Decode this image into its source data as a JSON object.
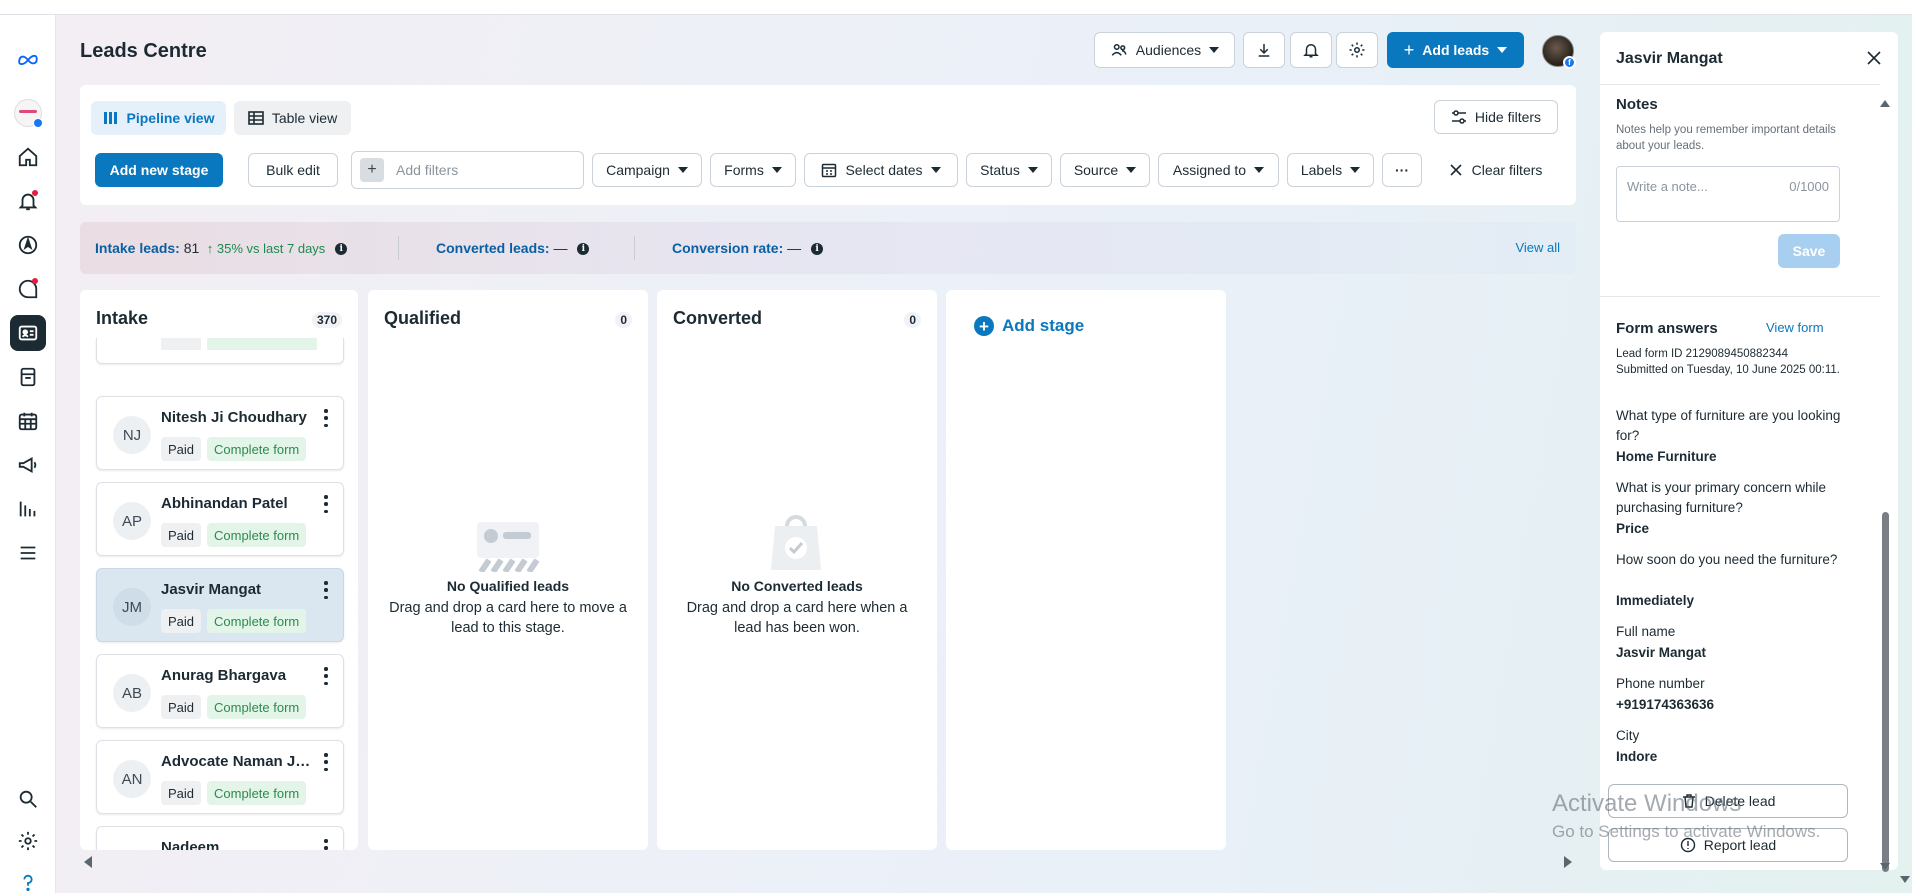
{
  "page": {
    "title": "Leads Centre"
  },
  "header": {
    "audiences_label": "Audiences",
    "add_leads_label": "Add leads"
  },
  "toolbar": {
    "pipeline_view": "Pipeline view",
    "table_view": "Table view",
    "hide_filters": "Hide filters",
    "add_new_stage": "Add new stage",
    "bulk_edit": "Bulk edit",
    "add_filters_placeholder": "Add filters",
    "filters": [
      "Campaign",
      "Forms",
      "Select dates",
      "Status",
      "Source",
      "Assigned to",
      "Labels"
    ],
    "more": "···",
    "clear_filters": "Clear filters"
  },
  "stats": {
    "intake_label": "Intake leads:",
    "intake_value": "81",
    "intake_change": "35% vs last 7 days",
    "converted_label": "Converted leads:",
    "converted_value": "—",
    "rate_label": "Conversion rate:",
    "rate_value": "—",
    "view_all": "View all"
  },
  "columns": {
    "intake": {
      "title": "Intake",
      "count": "370",
      "cards": [
        {
          "initials": "NJ",
          "name": "Nitesh Ji Choudhary",
          "paid": "Paid",
          "status": "Complete form"
        },
        {
          "initials": "AP",
          "name": "Abhinandan Patel",
          "paid": "Paid",
          "status": "Complete form"
        },
        {
          "initials": "JM",
          "name": "Jasvir Mangat",
          "paid": "Paid",
          "status": "Complete form"
        },
        {
          "initials": "AB",
          "name": "Anurag Bhargava",
          "paid": "Paid",
          "status": "Complete form"
        },
        {
          "initials": "AN",
          "name": "Advocate Naman Jain",
          "paid": "Paid",
          "status": "Complete form"
        },
        {
          "initials": "",
          "name": "Nadeem",
          "paid": "",
          "status": ""
        }
      ]
    },
    "qualified": {
      "title": "Qualified",
      "count": "0",
      "empty_title": "No Qualified leads",
      "empty_body": "Drag and drop a card here to move a lead to this stage."
    },
    "converted": {
      "title": "Converted",
      "count": "0",
      "empty_title": "No Converted leads",
      "empty_body": "Drag and drop a card here when a lead has been won."
    },
    "add_stage": "Add stage"
  },
  "panel": {
    "title": "Jasvir Mangat",
    "notes_title": "Notes",
    "notes_help": "Notes help you remember important details about your leads.",
    "note_placeholder": "Write a note...",
    "note_count": "0/1000",
    "save": "Save",
    "form_answers": "Form answers",
    "view_form": "View form",
    "lead_form_id": "Lead form ID 2129089450882344",
    "submitted": "Submitted on Tuesday, 10 June 2025 00:11.",
    "qa": [
      {
        "q": "What type of furniture are you looking for?",
        "a": "Home Furniture"
      },
      {
        "q": "What is your primary concern while purchasing furniture?",
        "a": "Price"
      },
      {
        "q": "How soon do you need the furniture?",
        "a": "Immediately"
      },
      {
        "q": "Full name",
        "a": "Jasvir Mangat"
      },
      {
        "q": "Phone number",
        "a": "+919174363636"
      },
      {
        "q": "City",
        "a": "Indore"
      }
    ],
    "delete_lead": "Delete lead",
    "report_lead": "Report lead"
  },
  "watermark": {
    "line1": "Activate Windows",
    "line2": "Go to Settings to activate Windows."
  },
  "colors": {
    "accent": "#0a78be",
    "success": "#2e8a4d",
    "sidebar_active": "#1c2b33"
  }
}
